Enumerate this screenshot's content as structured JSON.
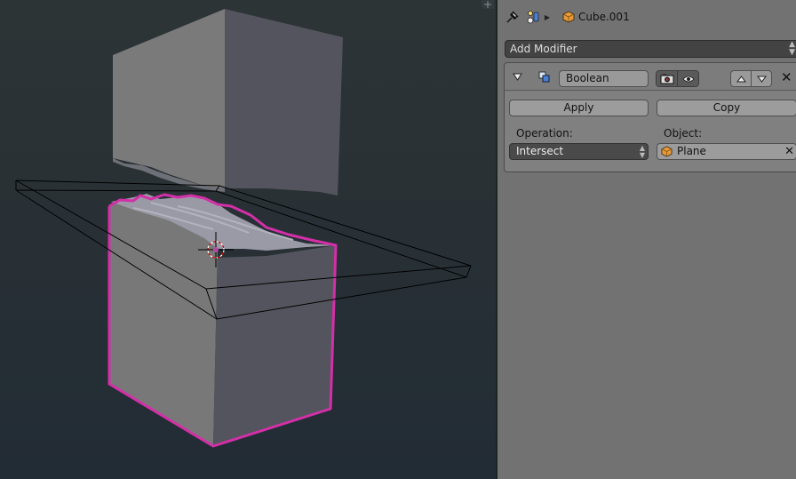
{
  "viewport": {
    "corner_widget_icon": "plus-icon",
    "colors": {
      "background_top": "#2c3436",
      "background_bottom": "#222c35",
      "selection_outline": "#d42fa8",
      "cube_light_face": "#787878",
      "cube_dark_face": "#54545e",
      "wireframe": "#000000"
    }
  },
  "properties": {
    "header": {
      "pin_icon": "pin-icon",
      "context_icon": "modifier-context-icon",
      "separator_icon": "chevron-right-icon",
      "object_icon": "cube-icon",
      "object_name": "Cube.001"
    },
    "add_modifier": {
      "label": "Add Modifier",
      "icon": "up-down-arrows-icon"
    },
    "modifier": {
      "expand_icon": "triangle-down-icon",
      "type_icon": "boolean-modifier-icon",
      "name": "Boolean",
      "render_toggle_icon": "camera-icon",
      "viewport_toggle_icon": "eye-icon",
      "move_up_icon": "triangle-up-icon",
      "move_down_icon": "triangle-down-icon",
      "remove_icon": "close-icon",
      "apply_label": "Apply",
      "copy_label": "Copy",
      "operation_label": "Operation:",
      "operation_value": "Intersect",
      "object_label": "Object:",
      "object_value": "Plane",
      "object_clear_icon": "close-icon"
    }
  }
}
